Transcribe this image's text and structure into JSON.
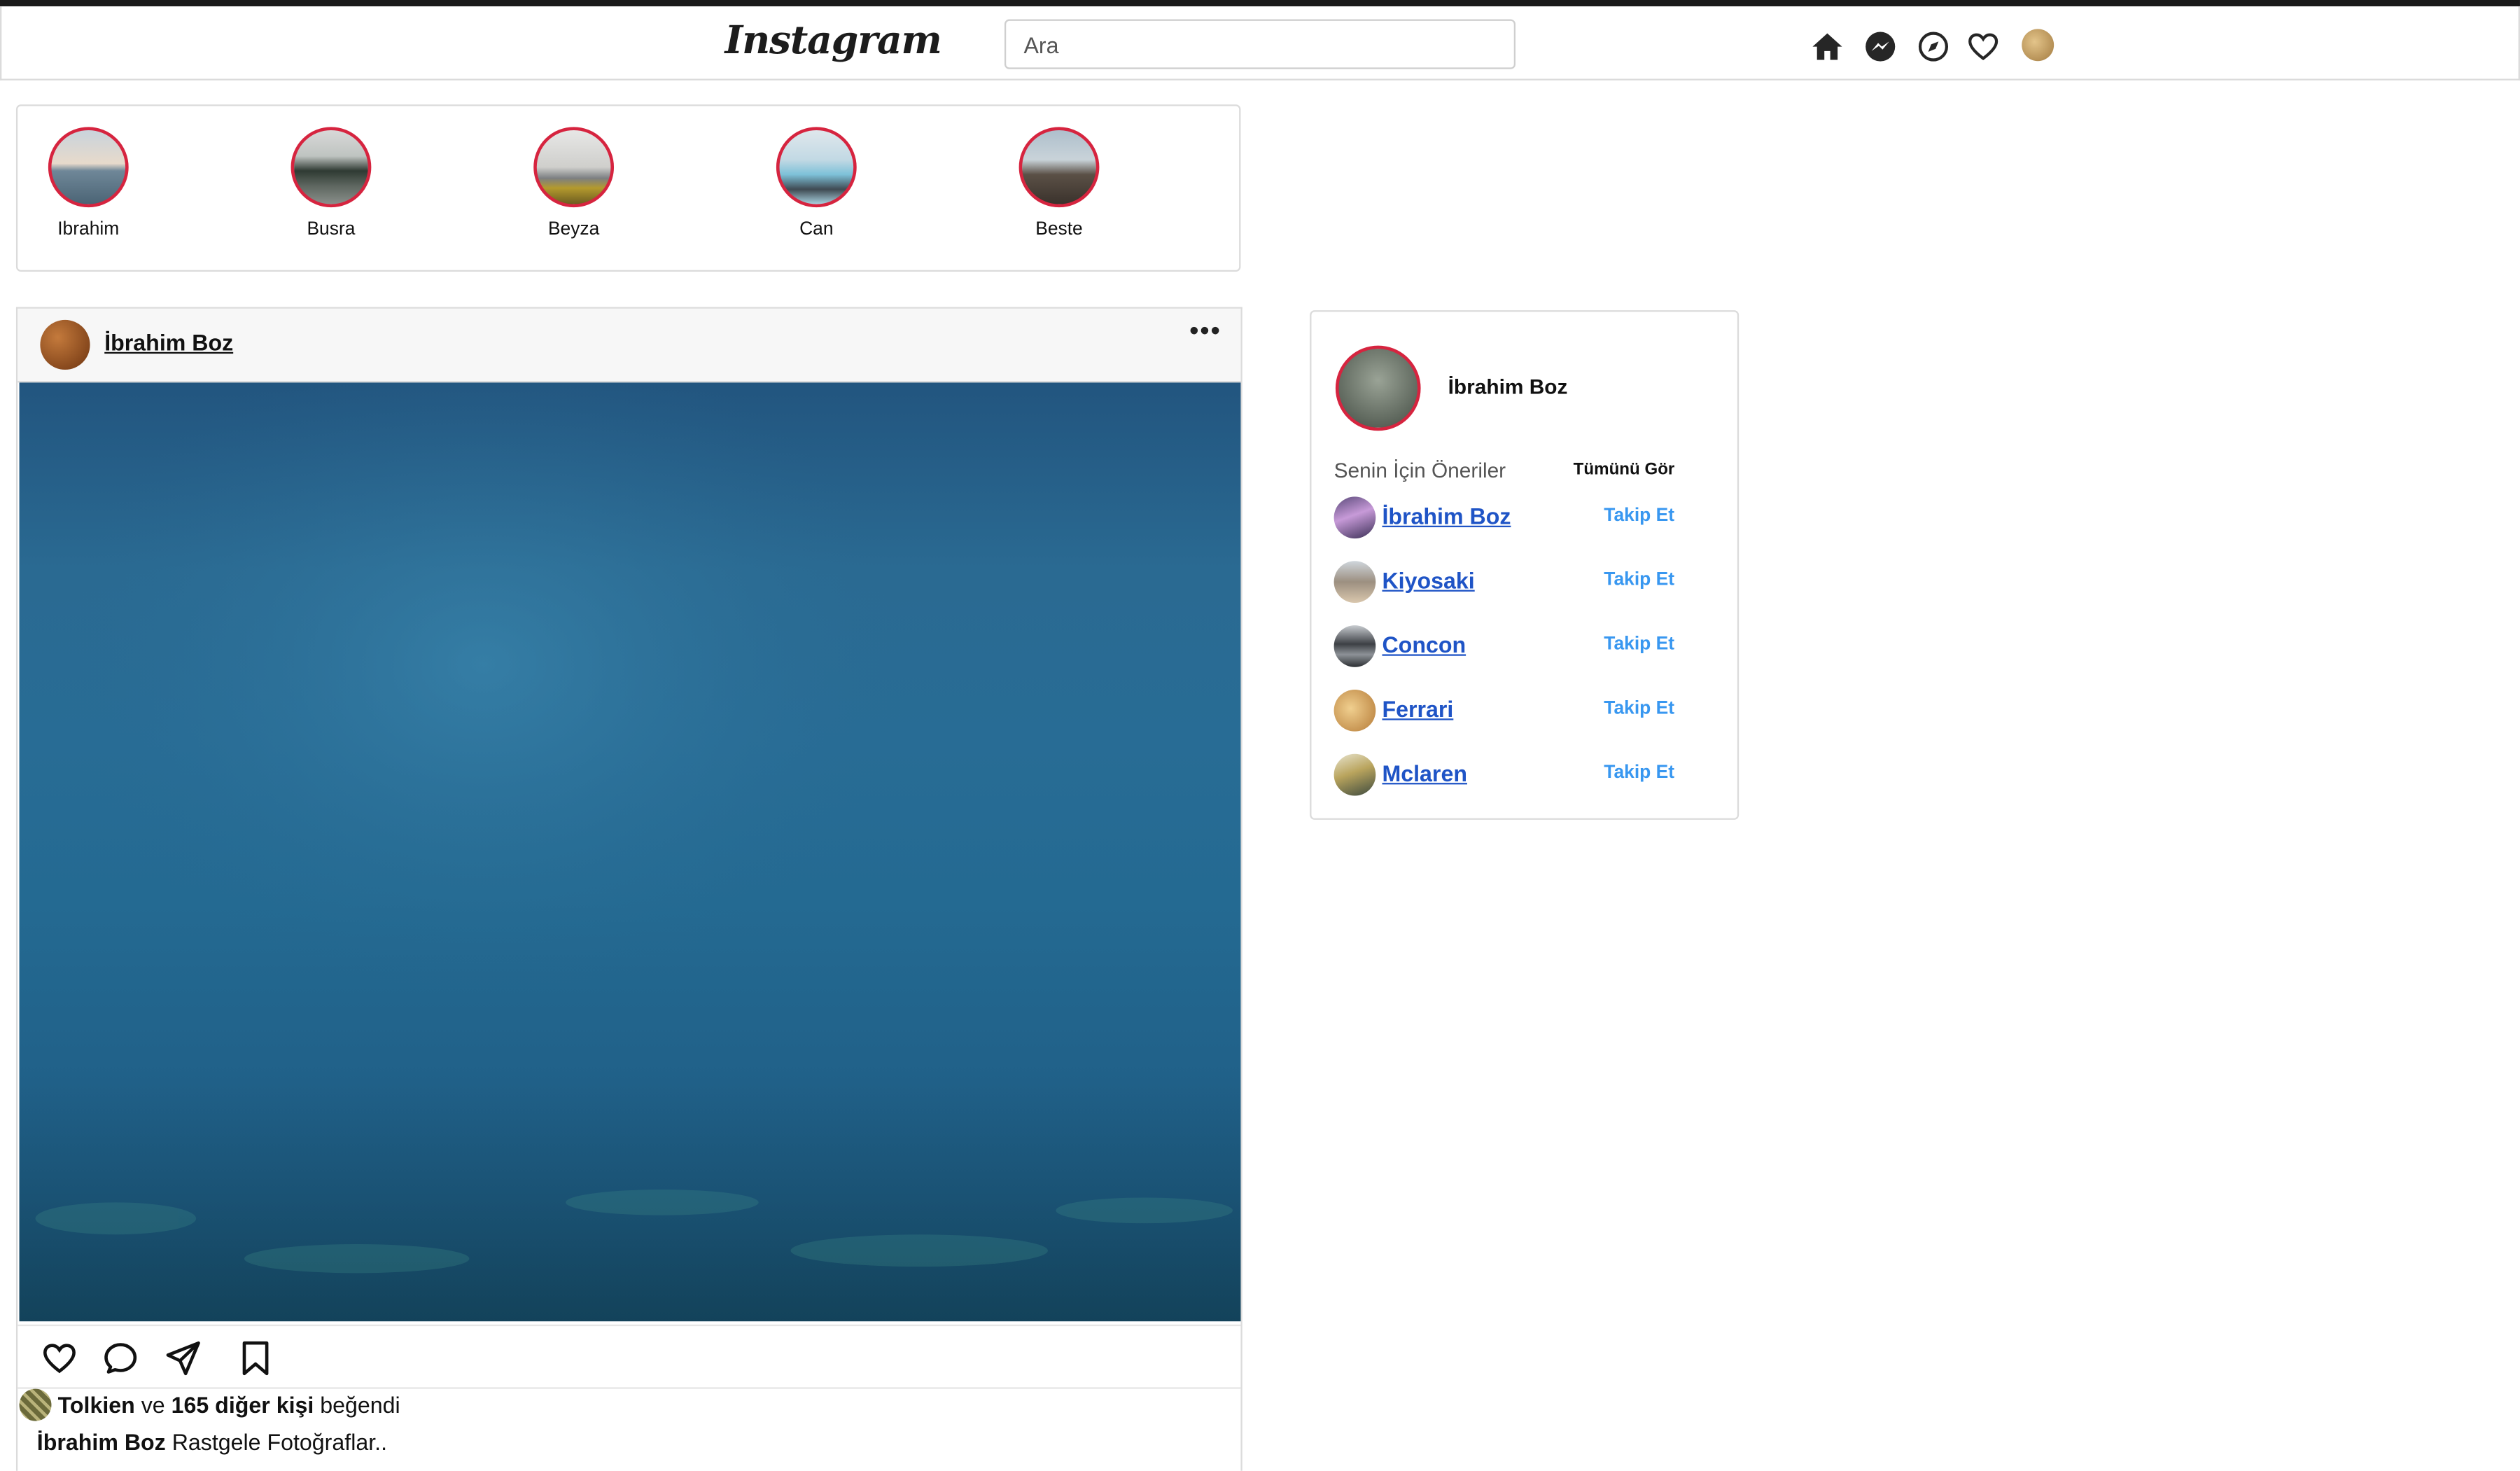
{
  "header": {
    "logo": "Instagram",
    "search": {
      "placeholder": "Ara"
    },
    "icons": [
      "home-icon",
      "messenger-icon",
      "explore-icon",
      "heart-icon",
      "profile-avatar"
    ]
  },
  "stories": [
    {
      "name": "Ibrahim"
    },
    {
      "name": "Busra"
    },
    {
      "name": "Beyza"
    },
    {
      "name": "Can"
    },
    {
      "name": "Beste"
    }
  ],
  "post": {
    "username": "İbrahim Boz",
    "more_icon": "•••",
    "liked_by": "Tolkien",
    "likes_connector": "ve",
    "likes_count_text": "165 diğer kişi",
    "likes_suffix": "beğendi",
    "caption_user": "İbrahim Boz",
    "caption_text": "Rastgele Fotoğraflar.."
  },
  "sidebar": {
    "username": "İbrahim Boz",
    "suggestions_title": "Senin İçin Öneriler",
    "see_all": "Tümünü Gör",
    "suggestions": [
      {
        "name": "İbrahim Boz",
        "action": "Takip Et"
      },
      {
        "name": "Kiyosaki",
        "action": "Takip Et"
      },
      {
        "name": "Concon",
        "action": "Takip Et"
      },
      {
        "name": "Ferrari",
        "action": "Takip Et"
      },
      {
        "name": "Mclaren",
        "action": "Takip Et"
      }
    ]
  },
  "colors": {
    "story_ring": "#d6243f",
    "link_blue": "#1f54c6",
    "follow_blue": "#3897f0",
    "border": "#dbdbdb"
  }
}
